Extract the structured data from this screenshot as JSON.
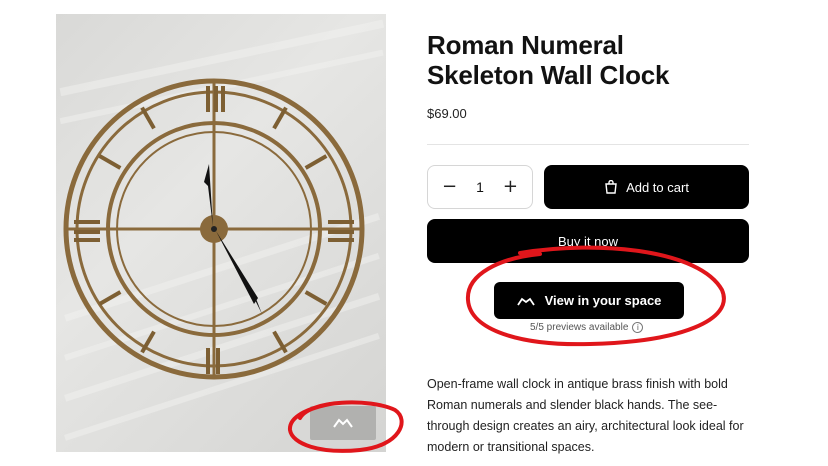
{
  "product": {
    "title_line1": "Roman Numeral",
    "title_line2": "Skeleton Wall Clock",
    "price": "$69.00",
    "quantity_value": "1",
    "minus_label": "−",
    "plus_label": "+",
    "add_to_cart_label": "Add to cart",
    "buy_now_label": "Buy it now",
    "view_in_space_label": "View in your space",
    "previews_text": "5/5 previews available",
    "info_glyph": "i",
    "description": "Open-frame wall clock in antique brass finish with bold Roman numerals and slender black hands. The see-through design creates an airy, architectural look ideal for modern or transitional spaces."
  },
  "media": {
    "image_subject": "clock-photo",
    "ar_icon": "ar-view-icon"
  },
  "icons": {
    "cart": "cart-icon",
    "ar": "ar-view-icon",
    "info": "info-icon"
  },
  "colors": {
    "button_bg": "#000000",
    "button_text": "#ffffff",
    "annotation": "#e0161b",
    "clock_brass": "#8a6a3c"
  }
}
